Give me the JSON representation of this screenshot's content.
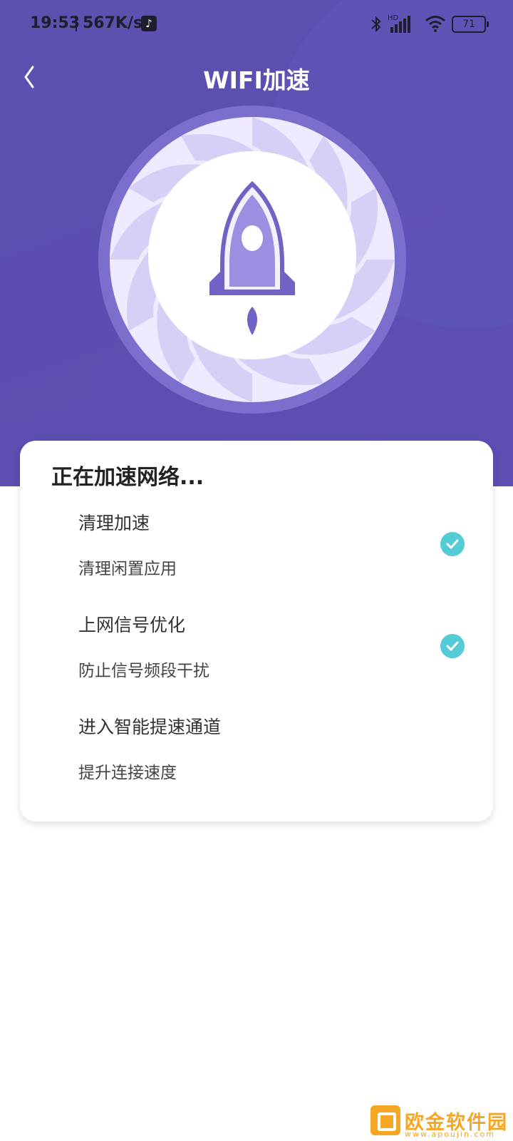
{
  "status_bar": {
    "time": "19:53",
    "net_speed": "567K/s",
    "battery": "71",
    "icons": [
      "tiktok-icon",
      "bluetooth-icon",
      "signal-hd-icon",
      "wifi-icon",
      "battery-icon"
    ]
  },
  "header": {
    "back_icon": "chevron-left-icon",
    "title": "WIFI加速"
  },
  "hero": {
    "icon": "rocket-icon",
    "accent": "#7b6fce",
    "ring": "#eeeaff"
  },
  "card": {
    "title": "正在加速网络...",
    "steps": [
      {
        "title": "清理加速",
        "desc": "清理闲置应用",
        "status": "done"
      },
      {
        "title": "上网信号优化",
        "desc": "防止信号频段干扰",
        "status": "done"
      },
      {
        "title": "进入智能提速通道",
        "desc": "提升连接速度",
        "status": "pending"
      }
    ]
  },
  "watermark": {
    "text": "欧金软件园",
    "url": "www.apoujin.com"
  },
  "colors": {
    "header_bg": "#5a4fb0",
    "check": "#54ccd8",
    "watermark": "#f5a623"
  }
}
